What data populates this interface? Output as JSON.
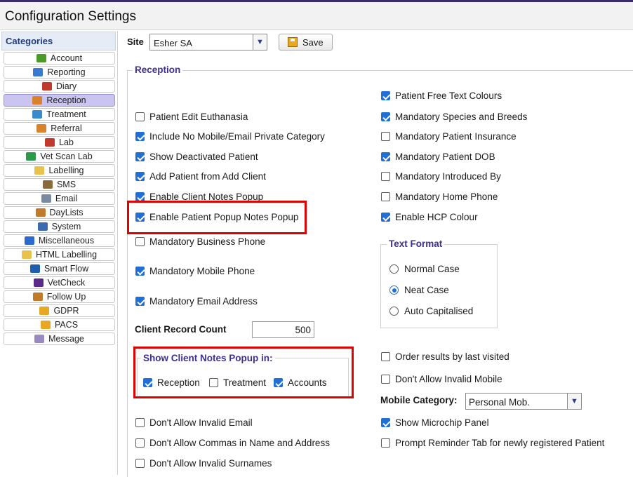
{
  "window": {
    "title": "Configuration Settings"
  },
  "sidebar": {
    "header": "Categories",
    "items": [
      {
        "label": "Account",
        "icon": "account-icon",
        "color": "#4a9a2a"
      },
      {
        "label": "Reporting",
        "icon": "reporting-icon",
        "color": "#3a7ad0"
      },
      {
        "label": "Diary",
        "icon": "diary-icon",
        "color": "#c0392b"
      },
      {
        "label": "Reception",
        "icon": "reception-icon",
        "color": "#d9822b",
        "active": true
      },
      {
        "label": "Treatment",
        "icon": "treatment-icon",
        "color": "#3a8ad0"
      },
      {
        "label": "Referral",
        "icon": "referral-icon",
        "color": "#d9822b"
      },
      {
        "label": "Lab",
        "icon": "lab-icon",
        "color": "#c0392b"
      },
      {
        "label": "Vet Scan Lab",
        "icon": "vet-scan-lab-icon",
        "color": "#2a9a4a"
      },
      {
        "label": "Labelling",
        "icon": "labelling-icon",
        "color": "#e8c24a"
      },
      {
        "label": "SMS",
        "icon": "sms-icon",
        "color": "#8a6a3a"
      },
      {
        "label": "Email",
        "icon": "email-icon",
        "color": "#7a8aa0"
      },
      {
        "label": "DayLists",
        "icon": "daylists-icon",
        "color": "#c07a2a"
      },
      {
        "label": "System",
        "icon": "system-icon",
        "color": "#3a6ab0"
      },
      {
        "label": "Miscellaneous",
        "icon": "info-icon",
        "color": "#2a6ad0"
      },
      {
        "label": "HTML Labelling",
        "icon": "html-labelling-icon",
        "color": "#e8c24a"
      },
      {
        "label": "Smart Flow",
        "icon": "smart-flow-icon",
        "color": "#1f5fb0"
      },
      {
        "label": "VetCheck",
        "icon": "vetcheck-icon",
        "color": "#5a2a8a"
      },
      {
        "label": "Follow Up",
        "icon": "follow-up-icon",
        "color": "#c07a2a"
      },
      {
        "label": "GDPR",
        "icon": "gdpr-icon",
        "color": "#e8a821"
      },
      {
        "label": "PACS",
        "icon": "pacs-icon",
        "color": "#e8a821"
      },
      {
        "label": "Message",
        "icon": "message-icon",
        "color": "#9a8ac0"
      }
    ]
  },
  "toolbar": {
    "site_label": "Site",
    "site_value": "Esher SA",
    "save_label": "Save"
  },
  "reception": {
    "legend": "Reception",
    "left_checks": [
      {
        "label": "Patient Edit Euthanasia",
        "checked": false
      },
      {
        "label": "Include No Mobile/Email Private Category",
        "checked": true
      },
      {
        "label": "Show Deactivated Patient",
        "checked": true
      },
      {
        "label": "Add Patient from Add Client",
        "checked": true
      },
      {
        "label": "Enable Client Notes Popup",
        "checked": true
      },
      {
        "label": "Enable Patient Popup Notes Popup",
        "checked": true
      },
      {
        "label": "Mandatory Business Phone",
        "checked": false
      },
      {
        "label": "Mandatory Mobile Phone",
        "checked": true
      },
      {
        "label": "Mandatory Email Address",
        "checked": true
      }
    ],
    "right_checks": [
      {
        "label": "Patient Free Text Colours",
        "checked": true
      },
      {
        "label": "Mandatory Species and Breeds",
        "checked": true
      },
      {
        "label": "Mandatory Patient Insurance",
        "checked": false
      },
      {
        "label": "Mandatory Patient DOB",
        "checked": true
      },
      {
        "label": "Mandatory Introduced By",
        "checked": false
      },
      {
        "label": "Mandatory Home Phone",
        "checked": false
      },
      {
        "label": "Enable HCP Colour",
        "checked": true
      }
    ],
    "client_record_count_label": "Client Record Count",
    "client_record_count_value": "500",
    "text_format": {
      "legend": "Text Format",
      "options": [
        {
          "label": "Normal Case",
          "selected": false
        },
        {
          "label": "Neat Case",
          "selected": true
        },
        {
          "label": "Auto Capitalised",
          "selected": false
        }
      ]
    },
    "popup_in": {
      "legend": "Show Client Notes Popup in:",
      "options": [
        {
          "label": "Reception",
          "checked": true
        },
        {
          "label": "Treatment",
          "checked": false
        },
        {
          "label": "Accounts",
          "checked": true
        }
      ]
    },
    "right_lower_checks": [
      {
        "label": "Order results by last visited",
        "checked": false
      },
      {
        "label": "Don't Allow Invalid Mobile",
        "checked": false
      }
    ],
    "mobile_category_label": "Mobile Category:",
    "mobile_category_value": "Personal Mob.",
    "right_bottom_checks": [
      {
        "label": "Show Microchip Panel",
        "checked": true
      },
      {
        "label": "Prompt Reminder Tab for newly registered Patient",
        "checked": false
      }
    ],
    "left_bottom_checks": [
      {
        "label": "Don't Allow Invalid Email",
        "checked": false
      },
      {
        "label": "Don't Allow Commas in Name and Address",
        "checked": false
      },
      {
        "label": "Don't Allow Invalid Surnames",
        "checked": false
      }
    ]
  }
}
